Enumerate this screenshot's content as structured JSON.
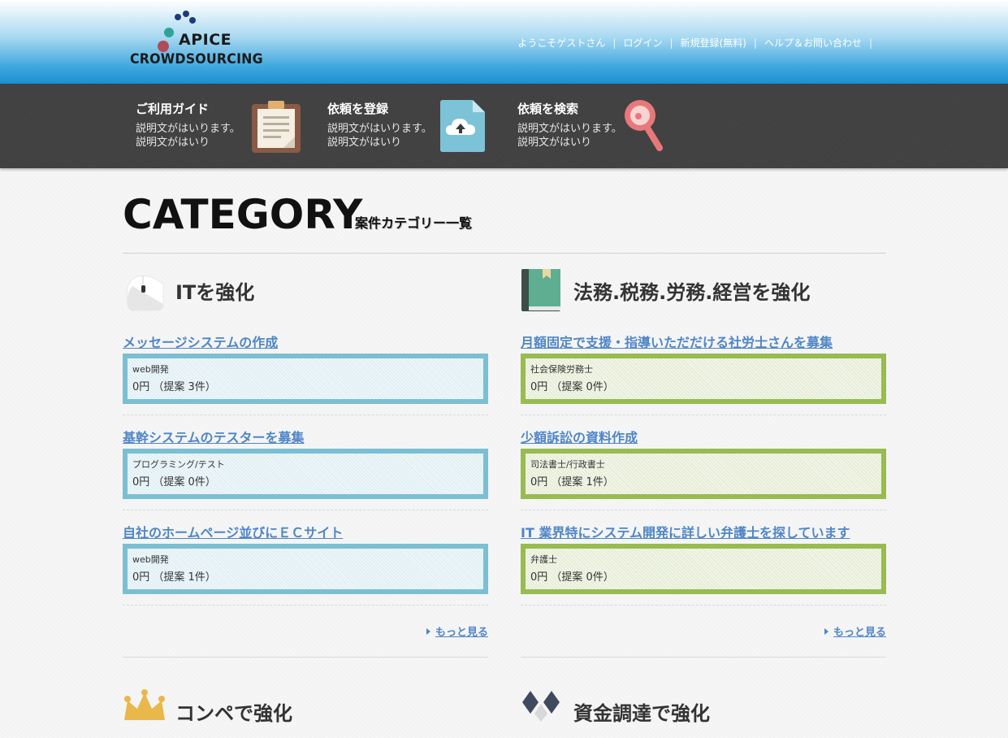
{
  "header": {
    "logo_line1": "APICE",
    "logo_line2": "CROWDSOURCING",
    "nav": [
      {
        "label": "ようこそゲストさん"
      },
      {
        "label": "ログイン"
      },
      {
        "label": "新規登録(無料)"
      },
      {
        "label": "ヘルプ＆お問い合わせ"
      }
    ],
    "separator": "|"
  },
  "features": [
    {
      "title": "ご利用ガイド",
      "desc": "説明文がはいります。説明文がはいり",
      "icon": "clipboard-icon"
    },
    {
      "title": "依頼を登録",
      "desc": "説明文がはいります。説明文がはいり",
      "icon": "cloud-upload-icon"
    },
    {
      "title": "依頼を検索",
      "desc": "説明文がはいります。説明文がはいり",
      "icon": "magnifier-icon"
    }
  ],
  "heading": {
    "title": "CATEGORY",
    "subtitle": "案件カテゴリー一覧"
  },
  "sections": [
    {
      "title": "ITを強化",
      "icon": "mouse-icon",
      "more": "もっと見る",
      "items": [
        {
          "title": "メッセージシステムの作成",
          "category": "web開発",
          "price": "0円 （提案 3件）"
        },
        {
          "title": "基幹システムのテスターを募集",
          "category": "プログラミング/テスト",
          "price": "0円 （提案 0件）"
        },
        {
          "title": "自社のホームページ並びにＥＣサイト",
          "category": "web開発",
          "price": "0円 （提案 1件）"
        }
      ]
    },
    {
      "title": "法務.税務.労務.経営を強化",
      "icon": "book-icon",
      "more": "もっと見る",
      "items": [
        {
          "title": "月額固定で支援・指導いただだける社労士さんを募集",
          "category": "社会保険労務士",
          "price": "0円 （提案 0件）"
        },
        {
          "title": "少額訴訟の資料作成",
          "category": "司法書士/行政書士",
          "price": "0円 （提案 1件）"
        },
        {
          "title": "IT 業界特にシステム開発に詳しい弁護士を探しています",
          "category": "弁護士",
          "price": "0円 （提案 0件）"
        }
      ]
    }
  ],
  "sections_bottom": [
    {
      "title": "コンペで強化",
      "icon": "crown-icon"
    },
    {
      "title": "資金調達で強化",
      "icon": "diamond-icon"
    }
  ],
  "colors": {
    "link": "#4f86c6",
    "it_border": "#7cbfd3",
    "legal_border": "#98bb52",
    "darkbar": "#404040"
  }
}
